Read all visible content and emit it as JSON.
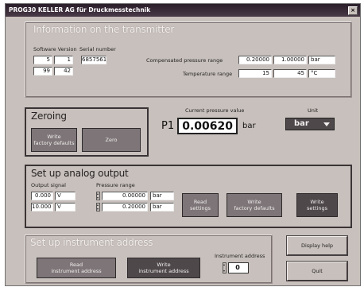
{
  "window": {
    "title": "PROG30  KELLER AG für Druckmesstechnik",
    "close_glyph": "×"
  },
  "info": {
    "title": "Information on the transmitter",
    "software_version_label": "Software Version",
    "serial_number_label": "Serial number",
    "sw_a": "5",
    "sw_b": "1",
    "sw_c": "99",
    "sw_d": "42",
    "serial": "6857561",
    "comp_range_label": "Compensated pressure range",
    "comp_min": "0.20000",
    "comp_max": "1.00000",
    "comp_unit": "bar",
    "temp_range_label": "Temperature range",
    "temp_min": "15",
    "temp_max": "45",
    "temp_unit": "°C"
  },
  "zeroing": {
    "title": "Zeroing",
    "write_factory_label": "Write\nfactory defaults",
    "zero_label": "Zero"
  },
  "pressure": {
    "current_label": "Current pressure value",
    "channel": "P1",
    "value": "0.00620",
    "unit": "bar",
    "unit_select_label": "Unit",
    "unit_selected": "bar"
  },
  "analog": {
    "title": "Set up analog output",
    "output_signal_label": "Output signal",
    "pressure_range_label": "Pressure range",
    "out_min": "0.000",
    "out_min_unit": "V",
    "out_max": "10.000",
    "out_max_unit": "V",
    "pr_min": "0.00000",
    "pr_min_unit": "bar",
    "pr_max": "0.20000",
    "pr_max_unit": "bar",
    "read_settings_label": "Read\nsettings",
    "write_factory_label": "Write\nfactory defaults",
    "write_settings_label": "Write\nsettings"
  },
  "address": {
    "title": "Set up instrument address",
    "read_label": "Read\ninstrument address",
    "write_label": "Write\ninstrument address",
    "instrument_address_label": "Instrument address",
    "address_value": "0"
  },
  "actions": {
    "display_help_label": "Display help",
    "quit_label": "Quit"
  }
}
